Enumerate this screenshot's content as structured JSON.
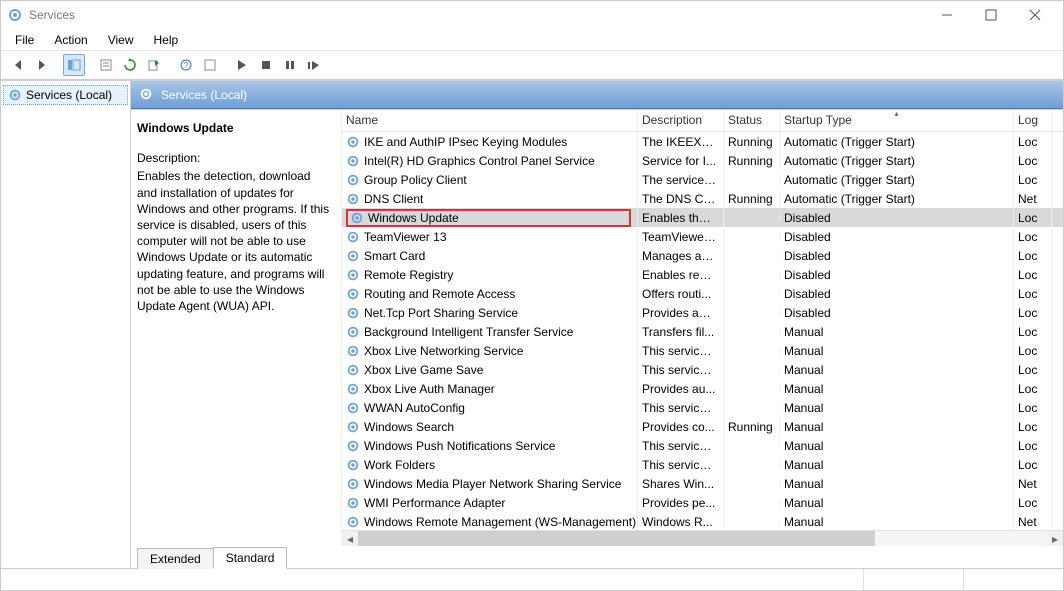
{
  "window": {
    "title": "Services"
  },
  "menubar": [
    "File",
    "Action",
    "View",
    "Help"
  ],
  "tree": {
    "root": "Services (Local)"
  },
  "header": {
    "title": "Services (Local)"
  },
  "detail": {
    "service_name": "Windows Update",
    "description_label": "Description:",
    "description_text": "Enables the detection, download and installation of updates for Windows and other programs. If this service is disabled, users of this computer will not be able to use Windows Update or its automatic updating feature, and programs will not be able to use the Windows Update Agent (WUA) API."
  },
  "columns": {
    "name": "Name",
    "description": "Description",
    "status": "Status",
    "startup": "Startup Type",
    "logon": "Log"
  },
  "rows": [
    {
      "name": "IKE and AuthIP IPsec Keying Modules",
      "desc": "The IKEEXT ...",
      "status": "Running",
      "startup": "Automatic (Trigger Start)",
      "log": "Loc"
    },
    {
      "name": "Intel(R) HD Graphics Control Panel Service",
      "desc": "Service for I...",
      "status": "Running",
      "startup": "Automatic (Trigger Start)",
      "log": "Loc"
    },
    {
      "name": "Group Policy Client",
      "desc": "The service ...",
      "status": "",
      "startup": "Automatic (Trigger Start)",
      "log": "Loc"
    },
    {
      "name": "DNS Client",
      "desc": "The DNS Cli...",
      "status": "Running",
      "startup": "Automatic (Trigger Start)",
      "log": "Net"
    },
    {
      "name": "Windows Update",
      "desc": "Enables the ...",
      "status": "",
      "startup": "Disabled",
      "log": "Loc",
      "selected": true,
      "highlighted": true
    },
    {
      "name": "TeamViewer 13",
      "desc": "TeamViewer...",
      "status": "",
      "startup": "Disabled",
      "log": "Loc"
    },
    {
      "name": "Smart Card",
      "desc": "Manages ac...",
      "status": "",
      "startup": "Disabled",
      "log": "Loc"
    },
    {
      "name": "Remote Registry",
      "desc": "Enables rem...",
      "status": "",
      "startup": "Disabled",
      "log": "Loc"
    },
    {
      "name": "Routing and Remote Access",
      "desc": "Offers routi...",
      "status": "",
      "startup": "Disabled",
      "log": "Loc"
    },
    {
      "name": "Net.Tcp Port Sharing Service",
      "desc": "Provides abi...",
      "status": "",
      "startup": "Disabled",
      "log": "Loc"
    },
    {
      "name": "Background Intelligent Transfer Service",
      "desc": "Transfers fil...",
      "status": "",
      "startup": "Manual",
      "log": "Loc"
    },
    {
      "name": "Xbox Live Networking Service",
      "desc": "This service ...",
      "status": "",
      "startup": "Manual",
      "log": "Loc"
    },
    {
      "name": "Xbox Live Game Save",
      "desc": "This service ...",
      "status": "",
      "startup": "Manual",
      "log": "Loc"
    },
    {
      "name": "Xbox Live Auth Manager",
      "desc": "Provides au...",
      "status": "",
      "startup": "Manual",
      "log": "Loc"
    },
    {
      "name": "WWAN AutoConfig",
      "desc": "This service ...",
      "status": "",
      "startup": "Manual",
      "log": "Loc"
    },
    {
      "name": "Windows Search",
      "desc": "Provides co...",
      "status": "Running",
      "startup": "Manual",
      "log": "Loc"
    },
    {
      "name": "Windows Push Notifications Service",
      "desc": "This service ...",
      "status": "",
      "startup": "Manual",
      "log": "Loc"
    },
    {
      "name": "Work Folders",
      "desc": "This service ...",
      "status": "",
      "startup": "Manual",
      "log": "Loc"
    },
    {
      "name": "Windows Media Player Network Sharing Service",
      "desc": "Shares Win...",
      "status": "",
      "startup": "Manual",
      "log": "Net"
    },
    {
      "name": "WMI Performance Adapter",
      "desc": "Provides pe...",
      "status": "",
      "startup": "Manual",
      "log": "Loc"
    },
    {
      "name": "Windows Remote Management (WS-Management)",
      "desc": "Windows R...",
      "status": "",
      "startup": "Manual",
      "log": "Net"
    }
  ],
  "tabs": {
    "extended": "Extended",
    "standard": "Standard",
    "active": "Standard"
  }
}
